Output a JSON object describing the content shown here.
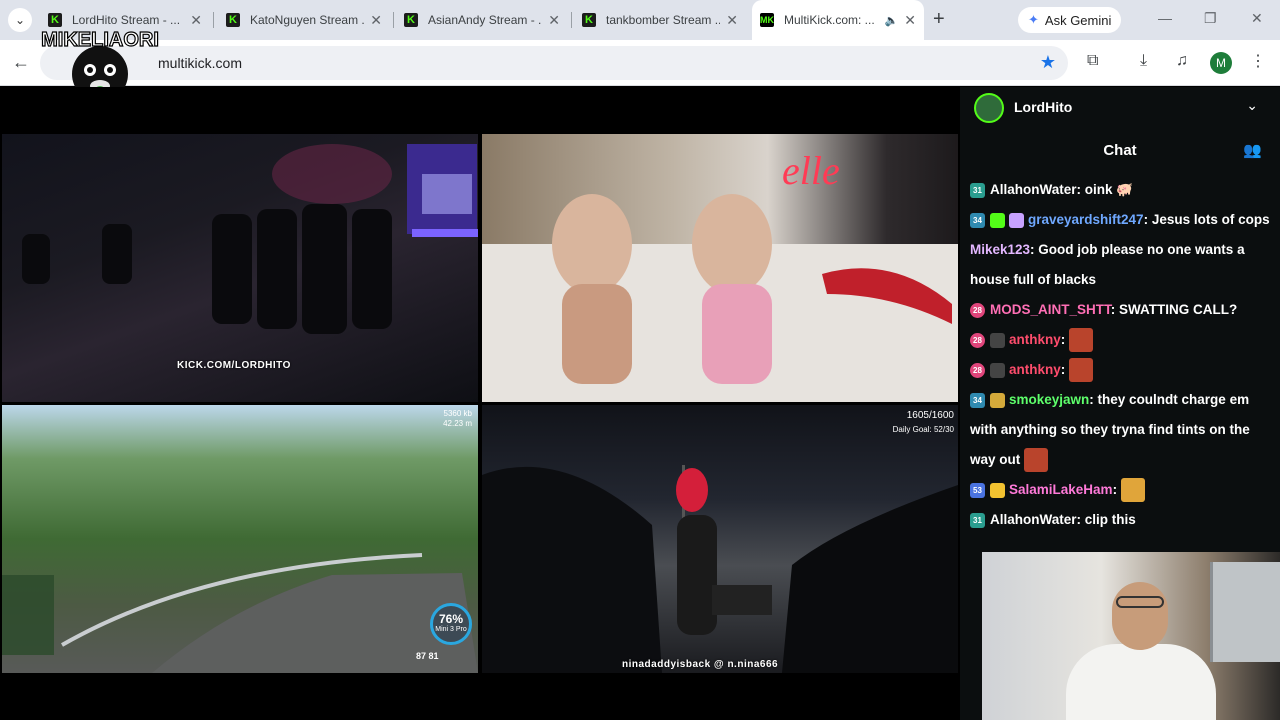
{
  "tabs": [
    {
      "label": "LordHito Stream - ...",
      "active": false
    },
    {
      "label": "KatoNguyen Stream ...",
      "active": false
    },
    {
      "label": "AsianAndy Stream - ...",
      "active": false
    },
    {
      "label": "tankbomber Stream ...",
      "active": false
    },
    {
      "label": "MultiKick.com: ...",
      "active": true
    }
  ],
  "gemini_label": "Ask Gemini",
  "url": "multikick.com",
  "profile_initial": "M",
  "overlay_logo_text": "MIKELIAORI",
  "videos": {
    "v1_watermark": "KICK.COM/LORDHITO",
    "v3_stat": "5360 kb\n42.23 m",
    "v3_gauge_pct": "76%",
    "v3_gauge_sub": "Mini 3 Pro",
    "v3_counts": "87   81",
    "v4_count": "1605/1600",
    "v4_goal": "Daily Goal: 52/30",
    "v4_watermark": "ninadaddyisback   @ n.nina666"
  },
  "chat": {
    "channel": "LordHito",
    "title": "Chat",
    "messages": [
      {
        "badge": "31",
        "user": "AllahonWater",
        "text": "oink"
      },
      {
        "badge": "34",
        "user": "graveyardshift247",
        "text": "Jesus lots of cops"
      },
      {
        "badge": "",
        "user": "Mikek123",
        "text": "Good job please no one wants a house full of blacks"
      },
      {
        "badge": "28",
        "user": "MODS_AINT_SHTT",
        "text": "SWATTING CALL?"
      },
      {
        "badge": "28",
        "user": "anthkny",
        "text": ""
      },
      {
        "badge": "28",
        "user": "anthkny",
        "text": ""
      },
      {
        "badge": "34",
        "user": "smokeyjawn",
        "text": "they coulndt charge em with anything so they tryna find tints on the way out"
      },
      {
        "badge": "53",
        "user": "SalamiLakeHam",
        "text": ""
      },
      {
        "badge": "31",
        "user": "AllahonWater",
        "text": "clip this"
      }
    ]
  },
  "colors": {
    "kick_green": "#53fc18",
    "chat_bg": "#0b0e0f",
    "accent_blue": "#1a73e8"
  }
}
